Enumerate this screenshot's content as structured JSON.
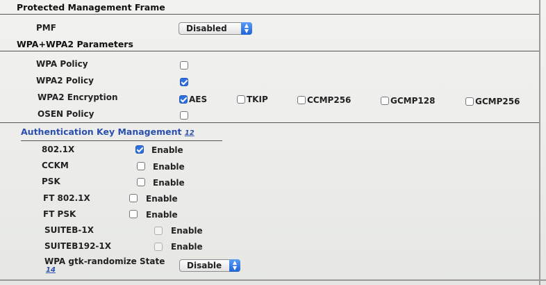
{
  "pmf_section": {
    "title": "Protected Management Frame",
    "pmf_label": "PMF",
    "pmf_value": "Disabled"
  },
  "wpa_section": {
    "title": "WPA+WPA2 Parameters",
    "wpa_policy": {
      "label": "WPA Policy",
      "checked": false
    },
    "wpa2_policy": {
      "label": "WPA2 Policy",
      "checked": true
    },
    "wpa2_encryption": {
      "label": "WPA2 Encryption",
      "options": [
        {
          "label": "AES",
          "checked": true
        },
        {
          "label": "TKIP",
          "checked": false
        },
        {
          "label": "CCMP256",
          "checked": false
        },
        {
          "label": "GCMP128",
          "checked": false
        },
        {
          "label": "GCMP256",
          "checked": false
        }
      ]
    },
    "osen_policy": {
      "label": "OSEN Policy",
      "checked": false
    }
  },
  "akm_section": {
    "title": "Authentication Key Management",
    "help_link": "12",
    "enable_label": "Enable",
    "items": [
      {
        "label": "802.1X",
        "checked": true
      },
      {
        "label": "CCKM",
        "checked": false
      },
      {
        "label": "PSK",
        "checked": false
      },
      {
        "label": "FT 802.1X",
        "checked": false
      },
      {
        "label": "FT PSK",
        "checked": false
      },
      {
        "label": "SUITEB-1X",
        "checked": false
      },
      {
        "label": "SUITEB192-1X",
        "checked": false
      }
    ],
    "gtk": {
      "label": "WPA gtk-randomize State",
      "help_link": "14",
      "value": "Disable"
    }
  },
  "colors": {
    "accent": "#2f6fe0",
    "section_link": "#2a4fae"
  }
}
